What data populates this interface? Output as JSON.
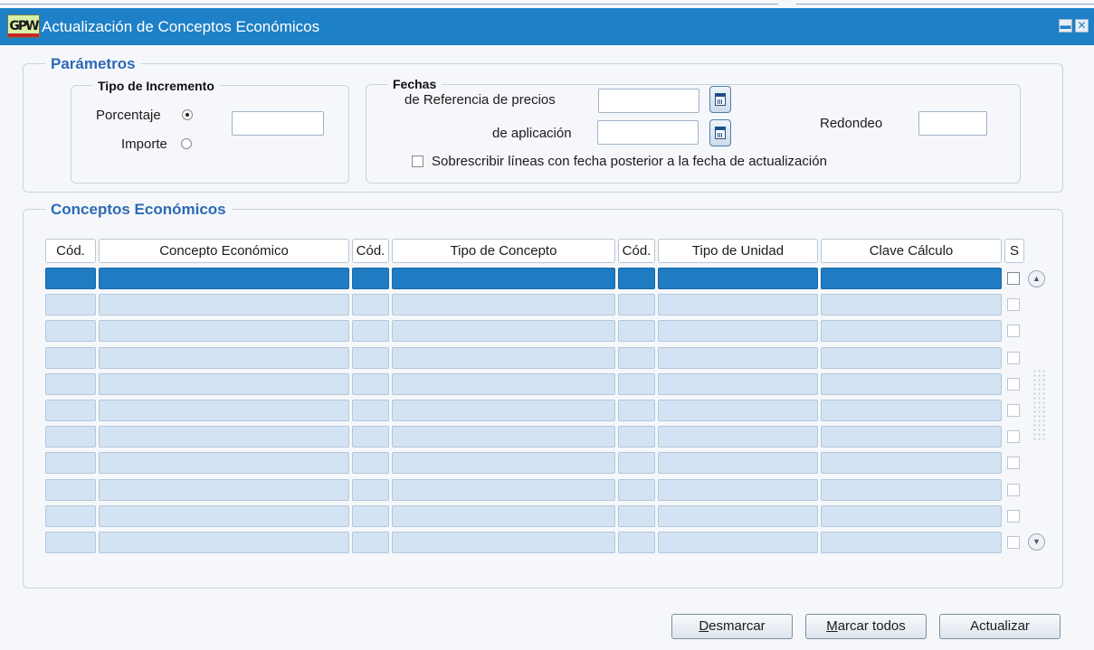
{
  "window": {
    "logo_text": "GPW",
    "title": "Actualización de Conceptos Económicos"
  },
  "parametros": {
    "legend": "Parámetros",
    "tipo_incremento": {
      "legend": "Tipo de Incremento",
      "porcentaje_label": "Porcentaje",
      "importe_label": "Importe",
      "selected": "Porcentaje",
      "value": ""
    },
    "fechas": {
      "legend": "Fechas",
      "referencia_label": "de Referencia de precios",
      "referencia_value": "",
      "aplicacion_label": "de aplicación",
      "aplicacion_value": "",
      "redondeo_label": "Redondeo",
      "redondeo_value": "",
      "sobrescribir_label": "Sobrescribir líneas con fecha posterior a la fecha de actualización",
      "sobrescribir_checked": false
    }
  },
  "conceptos": {
    "legend": "Conceptos Económicos",
    "columns": [
      "Cód.",
      "Concepto Económico",
      "Cód.",
      "Tipo de Concepto",
      "Cód.",
      "Tipo de Unidad",
      "Clave Cálculo",
      "S"
    ],
    "row_count": 11,
    "selected_row": 0
  },
  "buttons": {
    "desmarcar": "Desmarcar",
    "marcar_todos": "Marcar todos",
    "actualizar": "Actualizar"
  },
  "icons": {
    "calendar": "calendar-icon",
    "minimize": "minimize-icon",
    "close": "close-icon",
    "scroll_up": "scroll-up-icon",
    "scroll_down": "scroll-down-icon"
  },
  "colors": {
    "titlebar": "#1e80c6",
    "selected_row": "#1f7bc2",
    "row": "#d4e3f3",
    "legend_blue": "#2c6ab3"
  }
}
